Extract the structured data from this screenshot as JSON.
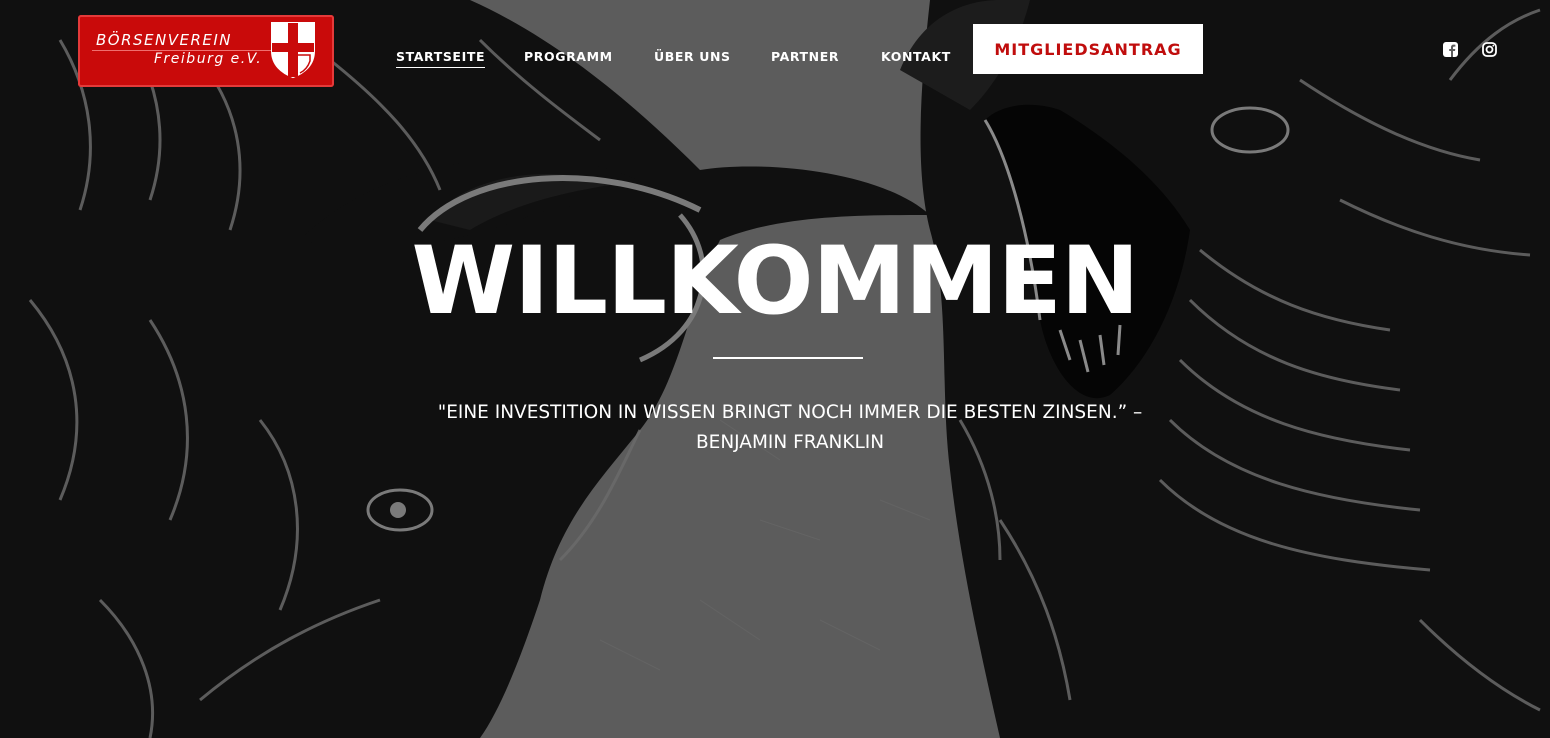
{
  "brand": {
    "name_line1": "BÖRSENVEREIN",
    "name_line2": "Freiburg e.V.",
    "accent_color": "#c90a0a"
  },
  "nav": {
    "items": [
      {
        "label": "STARTSEITE",
        "active": true
      },
      {
        "label": "PROGRAMM",
        "active": false
      },
      {
        "label": "ÜBER UNS",
        "active": false
      },
      {
        "label": "PARTNER",
        "active": false
      },
      {
        "label": "KONTAKT",
        "active": false
      }
    ],
    "cta_label": "MITGLIEDSANTRAG"
  },
  "social": {
    "icons": [
      "facebook-icon",
      "instagram-icon"
    ]
  },
  "hero": {
    "title": "WILLKOMMEN",
    "quote_line1": "\"EINE INVESTITION IN WISSEN BRINGT NOCH IMMER DIE BESTEN ZINSEN.” –",
    "quote_line2": "BENJAMIN FRANKLIN",
    "background_image": "bull-vs-bear-illustration"
  }
}
